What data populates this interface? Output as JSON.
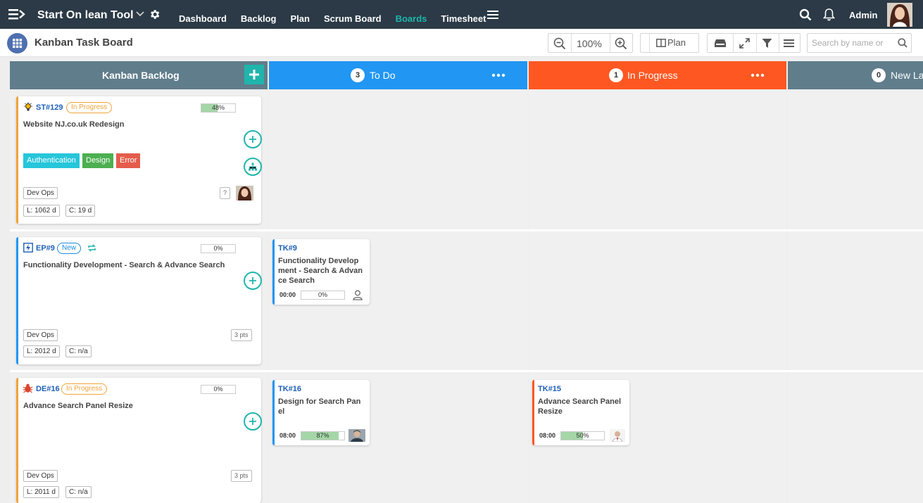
{
  "app": {
    "title": "Start On lean Tool"
  },
  "nav": {
    "items": [
      "Dashboard",
      "Backlog",
      "Plan",
      "Scrum Board",
      "Boards",
      "Timesheet"
    ],
    "active": "Boards"
  },
  "user": {
    "name": "Admin"
  },
  "subbar": {
    "title": "Kanban Task Board",
    "zoom": "100%",
    "plan_label": "Plan",
    "search_placeholder": "Search by name or"
  },
  "colors": {
    "topbar": "#2b3a46",
    "accent": "#1fb5ac",
    "todo": "#2196f3",
    "in_progress": "#ff5722",
    "backlog": "#607d8b"
  },
  "columns": [
    {
      "title": "Kanban Backlog"
    },
    {
      "title": "To Do",
      "count": "3"
    },
    {
      "title": "In Progress",
      "count": "1"
    },
    {
      "title": "New La",
      "count": "0"
    }
  ],
  "backlog_cards": [
    {
      "id": "ST#129",
      "status": "In Progress",
      "progress": "48%",
      "progress_value": 48,
      "title": "Website NJ.co.uk Redesign",
      "tags": [
        "Authentication",
        "Design",
        "Error"
      ],
      "team": "Dev Ops",
      "question": "?",
      "l": "L: 1062 d",
      "c": "C: 19 d"
    },
    {
      "id": "EP#9",
      "status": "New",
      "progress": "0%",
      "progress_value": 0,
      "title": "Functionality Development - Search & Advance Search",
      "team": "Dev Ops",
      "pts": "3 pts",
      "l": "L: 2012 d",
      "c": "C: n/a"
    },
    {
      "id": "DE#16",
      "status": "In Progress",
      "progress": "0%",
      "progress_value": 0,
      "title": "Advance Search Panel Resize",
      "team": "Dev Ops",
      "pts": "3 pts",
      "l": "L: 2011 d",
      "c": "C: n/a"
    }
  ],
  "tasks": [
    {
      "id": "TK#9",
      "title_lines": [
        "Functionality Develop",
        "ment - Search & Advan",
        "ce Search"
      ],
      "time": "00:00",
      "progress": "0%",
      "progress_value": 0
    },
    {
      "id": "TK#16",
      "title_lines": [
        "Design for Search Pan",
        "el"
      ],
      "time": "08:00",
      "progress": "87%",
      "progress_value": 87
    },
    {
      "id": "TK#15",
      "title_lines": [
        "Advance Search Panel",
        "Resize"
      ],
      "time": "08:00",
      "progress": "50%",
      "progress_value": 50
    }
  ]
}
